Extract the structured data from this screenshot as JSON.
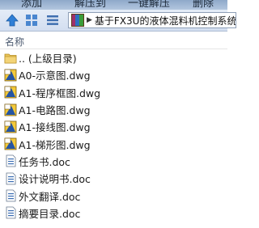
{
  "toolbar": {
    "buttons": [
      "添加",
      "解压到",
      "一键解压",
      "删除"
    ]
  },
  "address": {
    "path": "基于FX3U的液体混料机控制系统"
  },
  "list": {
    "column_header": "名称",
    "items": [
      {
        "name": ".. (上级目录)",
        "icon": "folder-up-icon"
      },
      {
        "name": "A0-示意图.dwg",
        "icon": "dwg-file-icon"
      },
      {
        "name": "A1-程序框图.dwg",
        "icon": "dwg-file-icon"
      },
      {
        "name": "A1-电路图.dwg",
        "icon": "dwg-file-icon"
      },
      {
        "name": "A1-接线图.dwg",
        "icon": "dwg-file-icon"
      },
      {
        "name": "A1-梯形图.dwg",
        "icon": "dwg-file-icon"
      },
      {
        "name": "任务书.doc",
        "icon": "doc-file-icon"
      },
      {
        "name": "设计说明书.doc",
        "icon": "doc-file-icon"
      },
      {
        "name": "外文翻译.doc",
        "icon": "doc-file-icon"
      },
      {
        "name": "摘要目录.doc",
        "icon": "doc-file-icon"
      }
    ]
  },
  "colors": {
    "toolbar": "#9fb6d4",
    "dwg_icon": "#e8b82c",
    "folder_icon": "#e9c45a",
    "doc_icon": "#3b6db3"
  }
}
